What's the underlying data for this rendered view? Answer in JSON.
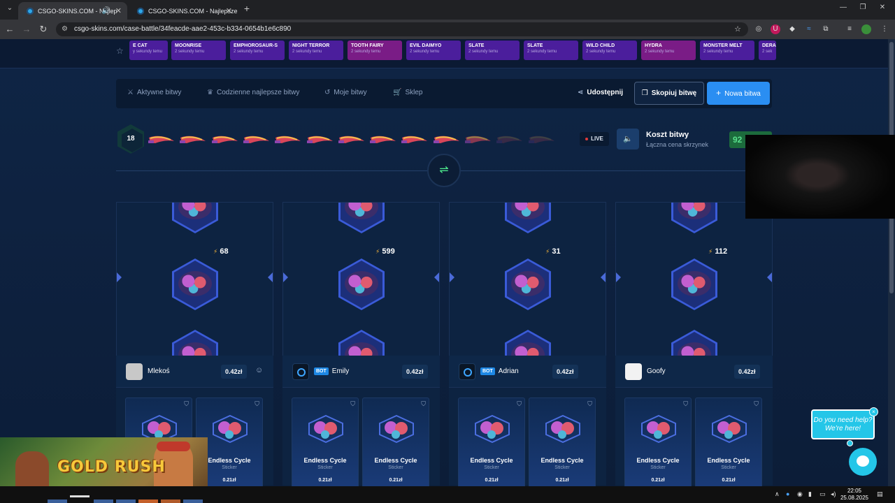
{
  "browser": {
    "tabs": [
      {
        "title": "CSGO-SKINS.COM - Najlep",
        "active": true
      },
      {
        "title": "CSGO-SKINS.COM - Najlepsze",
        "active": false
      }
    ],
    "url": "csgo-skins.com/case-battle/34feacde-aae2-453c-b334-0654b1e6c890",
    "new_tab": "+"
  },
  "live_drops": [
    {
      "name": "E CAT",
      "time": "y sekundy temu",
      "tone": "violet"
    },
    {
      "name": "MOONRISE",
      "time": "2 sekundy temu",
      "tone": "violet"
    },
    {
      "name": "EMPHOROSAUR-S",
      "time": "2 sekundy temu",
      "tone": "violet"
    },
    {
      "name": "NIGHT TERROR",
      "time": "2 sekundy temu",
      "tone": "violet"
    },
    {
      "name": "TOOTH FAIRY",
      "time": "2 sekundy temu",
      "tone": "pink"
    },
    {
      "name": "EVIL DAIMYO",
      "time": "2 sekundy temu",
      "tone": "violet"
    },
    {
      "name": "SLATE",
      "time": "2 sekundy temu",
      "tone": "violet"
    },
    {
      "name": "SLATE",
      "time": "2 sekundy temu",
      "tone": "violet"
    },
    {
      "name": "WILD CHILD",
      "time": "2 sekundy temu",
      "tone": "violet"
    },
    {
      "name": "HYDRA",
      "time": "2 sekundy temu",
      "tone": "pink"
    },
    {
      "name": "MONSTER MELT",
      "time": "2 sekundy temu",
      "tone": "violet"
    },
    {
      "name": "DERA",
      "time": "2 sek",
      "tone": "violet"
    }
  ],
  "nav": {
    "active_battles": "Aktywne bitwy",
    "daily_best": "Codzienne najlepsze bitwy",
    "my_battles": "Moje bitwy",
    "shop": "Sklep",
    "share": "Udostępnij",
    "copy_battle": "Skopiuj bitwę",
    "new_battle": "Nowa bitwa"
  },
  "battle": {
    "round": "18",
    "live": "LIVE",
    "cost_title": "Koszt bitwy",
    "cost_subtitle": "Łączna cena skrzynek",
    "cost_value": "92"
  },
  "players": [
    {
      "name": "Mlekoś",
      "bot": false,
      "price": "0.42zł",
      "spin_value": "68",
      "avatar": "user"
    },
    {
      "name": "Emily",
      "bot": true,
      "price": "0.42zł",
      "spin_value": "599",
      "avatar": "bot"
    },
    {
      "name": "Adrian",
      "bot": true,
      "price": "0.42zł",
      "spin_value": "31",
      "avatar": "bot"
    },
    {
      "name": "Goofy",
      "bot": false,
      "price": "0.42zł",
      "spin_value": "112",
      "avatar": "goofy"
    }
  ],
  "bot_label": "BOT",
  "item": {
    "name": "Endless Cycle",
    "type": "Sticker",
    "price": "0.21zł"
  },
  "overlays": {
    "game_title": "GOLD RUSH",
    "help_text": "Do you need help? We're here!",
    "help_close": "×"
  },
  "taskbar": {
    "time": "22:05",
    "date": "25.08.2025"
  },
  "colors": {
    "accent": "#2a8ef2",
    "live_green": "#58e08c",
    "page_bg": "#0e2240"
  }
}
